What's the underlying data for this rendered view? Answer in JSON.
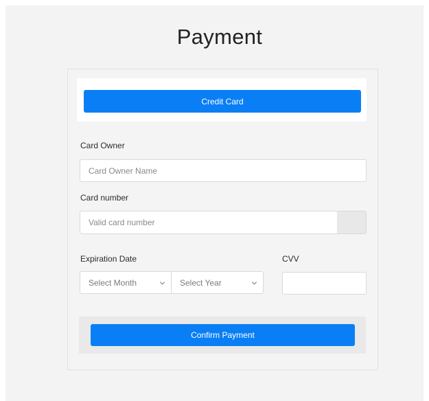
{
  "page": {
    "title": "Payment"
  },
  "tabs": {
    "credit_card_label": "Credit Card"
  },
  "form": {
    "card_owner": {
      "label": "Card Owner",
      "placeholder": "Card Owner Name",
      "value": ""
    },
    "card_number": {
      "label": "Card number",
      "placeholder": "Valid card number",
      "value": ""
    },
    "expiration": {
      "label": "Expiration Date",
      "month_selected": "Select Month",
      "year_selected": "Select Year"
    },
    "cvv": {
      "label": "CVV",
      "value": ""
    }
  },
  "actions": {
    "confirm_label": "Confirm Payment"
  },
  "colors": {
    "accent": "#0a7ff5",
    "background": "#f3f3f3",
    "card_background": "#f4f4f4"
  },
  "icons": {
    "select_arrow": "chevron-down-icon",
    "card_addon": "card-addon"
  }
}
